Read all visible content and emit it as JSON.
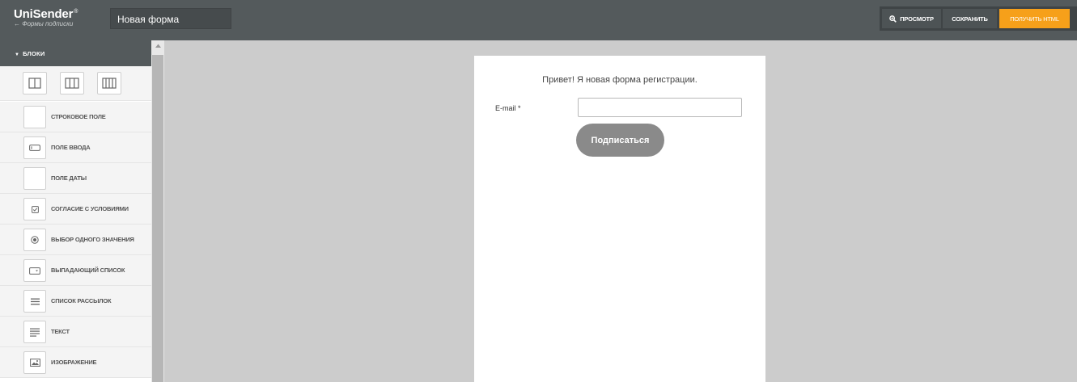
{
  "app": {
    "logo_title": "UniSender",
    "logo_trademark": "®",
    "back_link": "← Формы подписки",
    "form_name": "Новая форма"
  },
  "toolbar": {
    "preview_label": "Просмотр",
    "save_label": "Сохранить",
    "get_html_label": "Получить HTML"
  },
  "colors": {
    "topbar": "#545a5c",
    "accent": "#f6a01a",
    "submit_button": "#8a8a8a"
  },
  "sidebar": {
    "header": "Блоки",
    "layouts": [
      {
        "icon": "one-column-layout-icon"
      },
      {
        "icon": "two-column-layout-icon"
      },
      {
        "icon": "three-column-layout-icon"
      }
    ],
    "items": [
      {
        "label": "Строковое поле",
        "icon": "blank-icon"
      },
      {
        "label": "Поле ввода",
        "icon": "input-field-icon"
      },
      {
        "label": "Поле даты",
        "icon": "blank-icon"
      },
      {
        "label": "Согласие с условиями",
        "icon": "checkbox-icon"
      },
      {
        "label": "Выбор одного значения",
        "icon": "radio-icon"
      },
      {
        "label": "Выпадающий список",
        "icon": "dropdown-icon"
      },
      {
        "label": "Список рассылок",
        "icon": "list-icon"
      },
      {
        "label": "Текст",
        "icon": "text-icon"
      },
      {
        "label": "Изображение",
        "icon": "image-icon"
      }
    ]
  },
  "form": {
    "greeting": "Привет! Я новая форма регистрации.",
    "email_label": "E-mail *",
    "email_value": "",
    "submit_label": "Подписаться"
  }
}
